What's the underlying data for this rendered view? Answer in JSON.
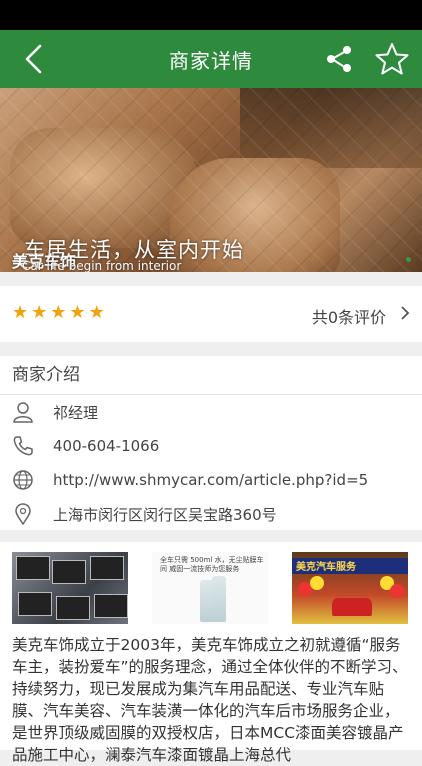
{
  "header": {
    "title": "商家详情"
  },
  "banner": {
    "slogan": "车居生活，从室内开始",
    "slogan_en": "Car life begin from interior",
    "shop_name": "美克车饰"
  },
  "rating": {
    "stars": 5,
    "count_label": "共0条评价"
  },
  "intro": {
    "title": "商家介绍",
    "contact": "祁经理",
    "phone": "400-604-1066",
    "website": "http://www.shmycar.com/article.php?id=5",
    "address": "上海市闵行区闵行区吴宝路360号"
  },
  "gallery": {
    "image2_caption": "全车只需 500ml 水，无尘贴膜车间 威固一流技师为您服务",
    "image3_sign": "美克汽车服务"
  },
  "description": "美克车饰成立于2003年，美克车饰成立之初就遵循“服务车主，装扮爱车”的服务理念，通过全体伙伴的不断学习、持续努力，现已发展成为集汽车用品配送、专业汽车贴膜、汽车美容、汽车装潢一体化的汽车后市场服务企业，是世界顶级威固膜的双授权店，日本MCC漆面美容镀晶产品施工中心，澜泰汽车漆面镀晶上海总代",
  "colors": {
    "header": "#2e8b3e",
    "star": "#f2a20c"
  }
}
